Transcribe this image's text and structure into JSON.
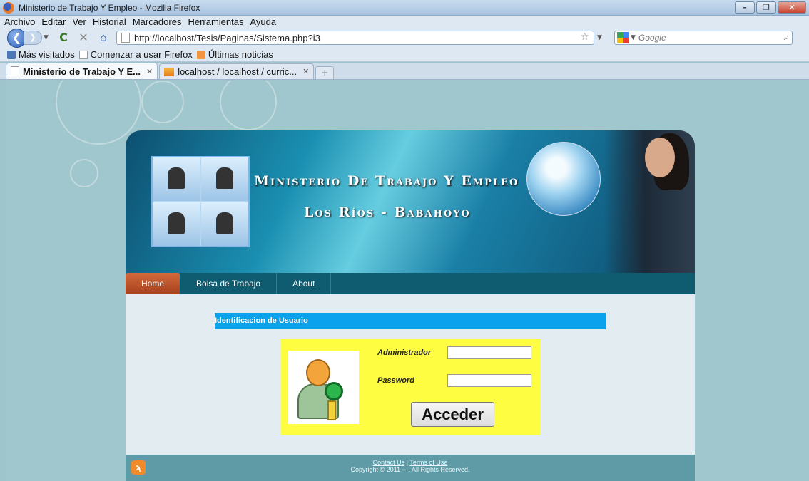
{
  "window": {
    "title": "Ministerio de Trabajo Y Empleo - Mozilla Firefox",
    "controls": [
      "–",
      "❐",
      "✕"
    ]
  },
  "menu": [
    "Archivo",
    "Editar",
    "Ver",
    "Historial",
    "Marcadores",
    "Herramientas",
    "Ayuda"
  ],
  "navbar": {
    "url": "http://localhost/Tesis/Paginas/Sistema.php?i3",
    "search_placeholder": "Google"
  },
  "bookmarks": [
    {
      "label": "Más visitados",
      "icon": "most-visited-icon"
    },
    {
      "label": "Comenzar a usar Firefox",
      "icon": "page-icon"
    },
    {
      "label": "Últimas noticias",
      "icon": "rss-icon"
    }
  ],
  "tabs": [
    {
      "label": "Ministerio de Trabajo Y E...",
      "active": true
    },
    {
      "label": "localhost / localhost / curric...",
      "active": false
    }
  ],
  "site": {
    "title_line1": "Ministerio De Trabajo Y Empleo",
    "title_line2": "Los Ríos - Babahoyo",
    "nav": [
      "Home",
      "Bolsa de Trabajo",
      "About"
    ],
    "form_title": "Identificacion de Usuario",
    "login": {
      "user_label": "Administrador",
      "password_label": "Password",
      "submit": "Acceder",
      "user_value": "",
      "password_value": ""
    },
    "footer": {
      "contact": "Contact Us",
      "terms": "Terms of Use",
      "copyright": "Copyright © 2011 ---. All Rights Reserved."
    }
  },
  "colors": {
    "form_title_bg": "#0aa2ec",
    "login_bg": "#fefd42",
    "nav_bg": "#0f5b70",
    "active_nav": "#c45a30"
  }
}
